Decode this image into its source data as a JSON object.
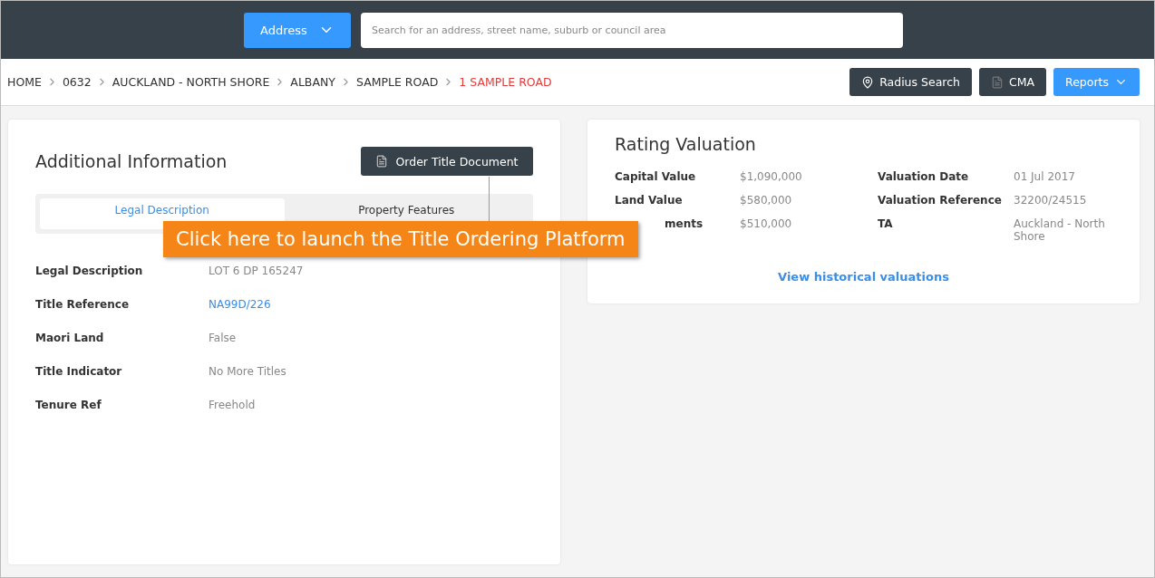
{
  "search_bar": {
    "type_button": "Address",
    "placeholder": "Search for an address, street name, suburb or council area"
  },
  "breadcrumbs": [
    {
      "label": "HOME",
      "current": false
    },
    {
      "label": "0632",
      "current": false
    },
    {
      "label": "AUCKLAND - NORTH SHORE",
      "current": false
    },
    {
      "label": "ALBANY",
      "current": false
    },
    {
      "label": "SAMPLE ROAD",
      "current": false
    },
    {
      "label": "1 SAMPLE ROAD",
      "current": true
    }
  ],
  "actions": [
    {
      "label": "Radius Search",
      "kind": "pin"
    },
    {
      "label": "CMA",
      "kind": "doc"
    },
    {
      "label": "Reports",
      "kind": "dropdown"
    }
  ],
  "additional_information": {
    "title": "Additional Information",
    "button": "Order Title Document",
    "tabs": [
      {
        "label": "Legal Description",
        "selected": true
      },
      {
        "label": "Property Features",
        "selected": false
      }
    ],
    "rows": [
      {
        "label": "Legal Description",
        "value": "LOT 6 DP 165247",
        "link": false
      },
      {
        "label": "Title Reference",
        "value": "NA99D/226",
        "link": true
      },
      {
        "label": "Maori Land",
        "value": "False",
        "link": false
      },
      {
        "label": "Title Indicator",
        "value": "No More Titles",
        "link": false
      },
      {
        "label": "Tenure Ref",
        "value": "Freehold",
        "link": false
      }
    ]
  },
  "callout": "Click here to launch the Title Ordering Platform",
  "rating_valuation": {
    "title": "Rating Valuation",
    "left": [
      {
        "label": "Capital Value",
        "value": "$1,090,000",
        "covered": false
      },
      {
        "label": "Land Value",
        "value": "$580,000",
        "covered": false
      },
      {
        "label": "ments",
        "value": "$510,000",
        "covered": true
      }
    ],
    "right": [
      {
        "label": "Valuation Date",
        "value": "01 Jul 2017"
      },
      {
        "label": "Valuation Reference",
        "value": "32200/24515"
      },
      {
        "label": "TA",
        "value": "Auckland - North Shore"
      }
    ],
    "link": "View historical valuations"
  }
}
